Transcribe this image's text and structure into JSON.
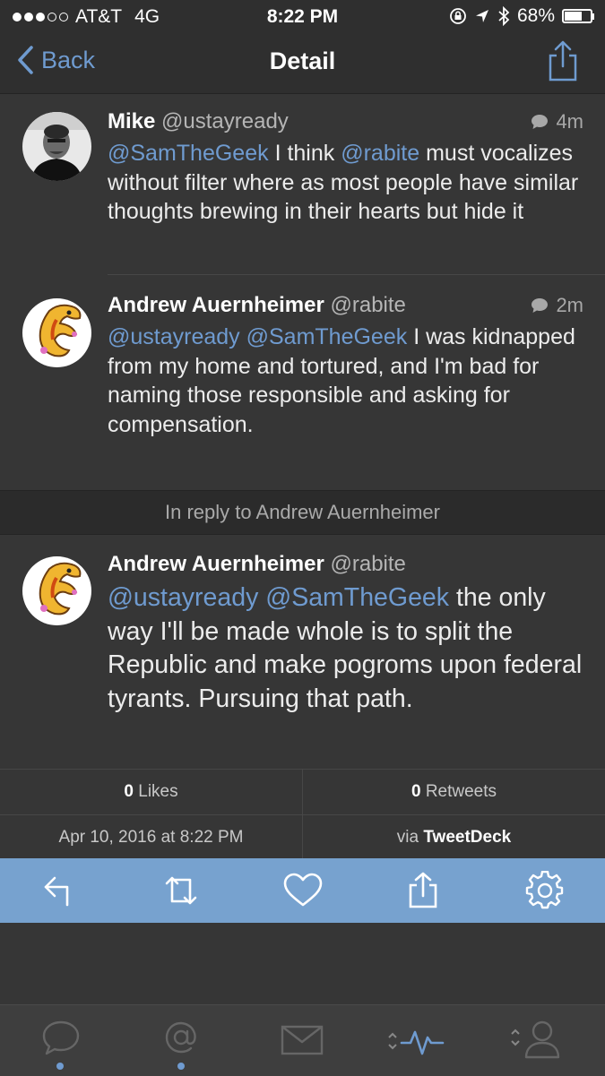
{
  "status_bar": {
    "carrier": "AT&T",
    "network": "4G",
    "time": "8:22 PM",
    "battery_text": "68%",
    "battery_level": 0.68,
    "signal_bars_filled": 3,
    "signal_bars_total": 5
  },
  "nav": {
    "back_label": "Back",
    "title": "Detail"
  },
  "tweets": [
    {
      "name": "Mike",
      "handle": "@ustayready",
      "time": "4m",
      "mentions": [
        "@SamTheGeek",
        "@rabite"
      ],
      "text_a": " I think ",
      "text_b": " must vocalizes without filter where as most people have similar thoughts brewing in their hearts but hide it"
    },
    {
      "name": "Andrew Auernheimer",
      "handle": "@rabite",
      "time": "2m",
      "mentions": [
        "@ustayready",
        "@SamTheGeek"
      ],
      "text": " I was kidnapped from my home and tortured, and I'm bad for naming those responsible and asking for compensation."
    }
  ],
  "reply_banner": "In reply to Andrew Auernheimer",
  "main_tweet": {
    "name": "Andrew Auernheimer",
    "handle": "@rabite",
    "mentions": [
      "@ustayready",
      "@SamTheGeek"
    ],
    "text": " the only way I'll be made whole is to split the Republic and make pogroms upon federal tyrants. Pursuing that path."
  },
  "stats": {
    "likes_count": "0",
    "likes_label": " Likes",
    "retweets_count": "0",
    "retweets_label": " Retweets",
    "date": "Apr 10, 2016 at 8:22 PM",
    "via_label": "via ",
    "client": "TweetDeck"
  },
  "actions": [
    "reply-icon",
    "retweet-icon",
    "like-icon",
    "share-icon",
    "settings-icon"
  ],
  "tabs": [
    "timeline-icon",
    "mentions-icon",
    "messages-icon",
    "activity-icon",
    "profile-icon"
  ],
  "colors": {
    "accent": "#6f9bd0",
    "background": "#363636",
    "action_bar": "#77a2cf"
  }
}
